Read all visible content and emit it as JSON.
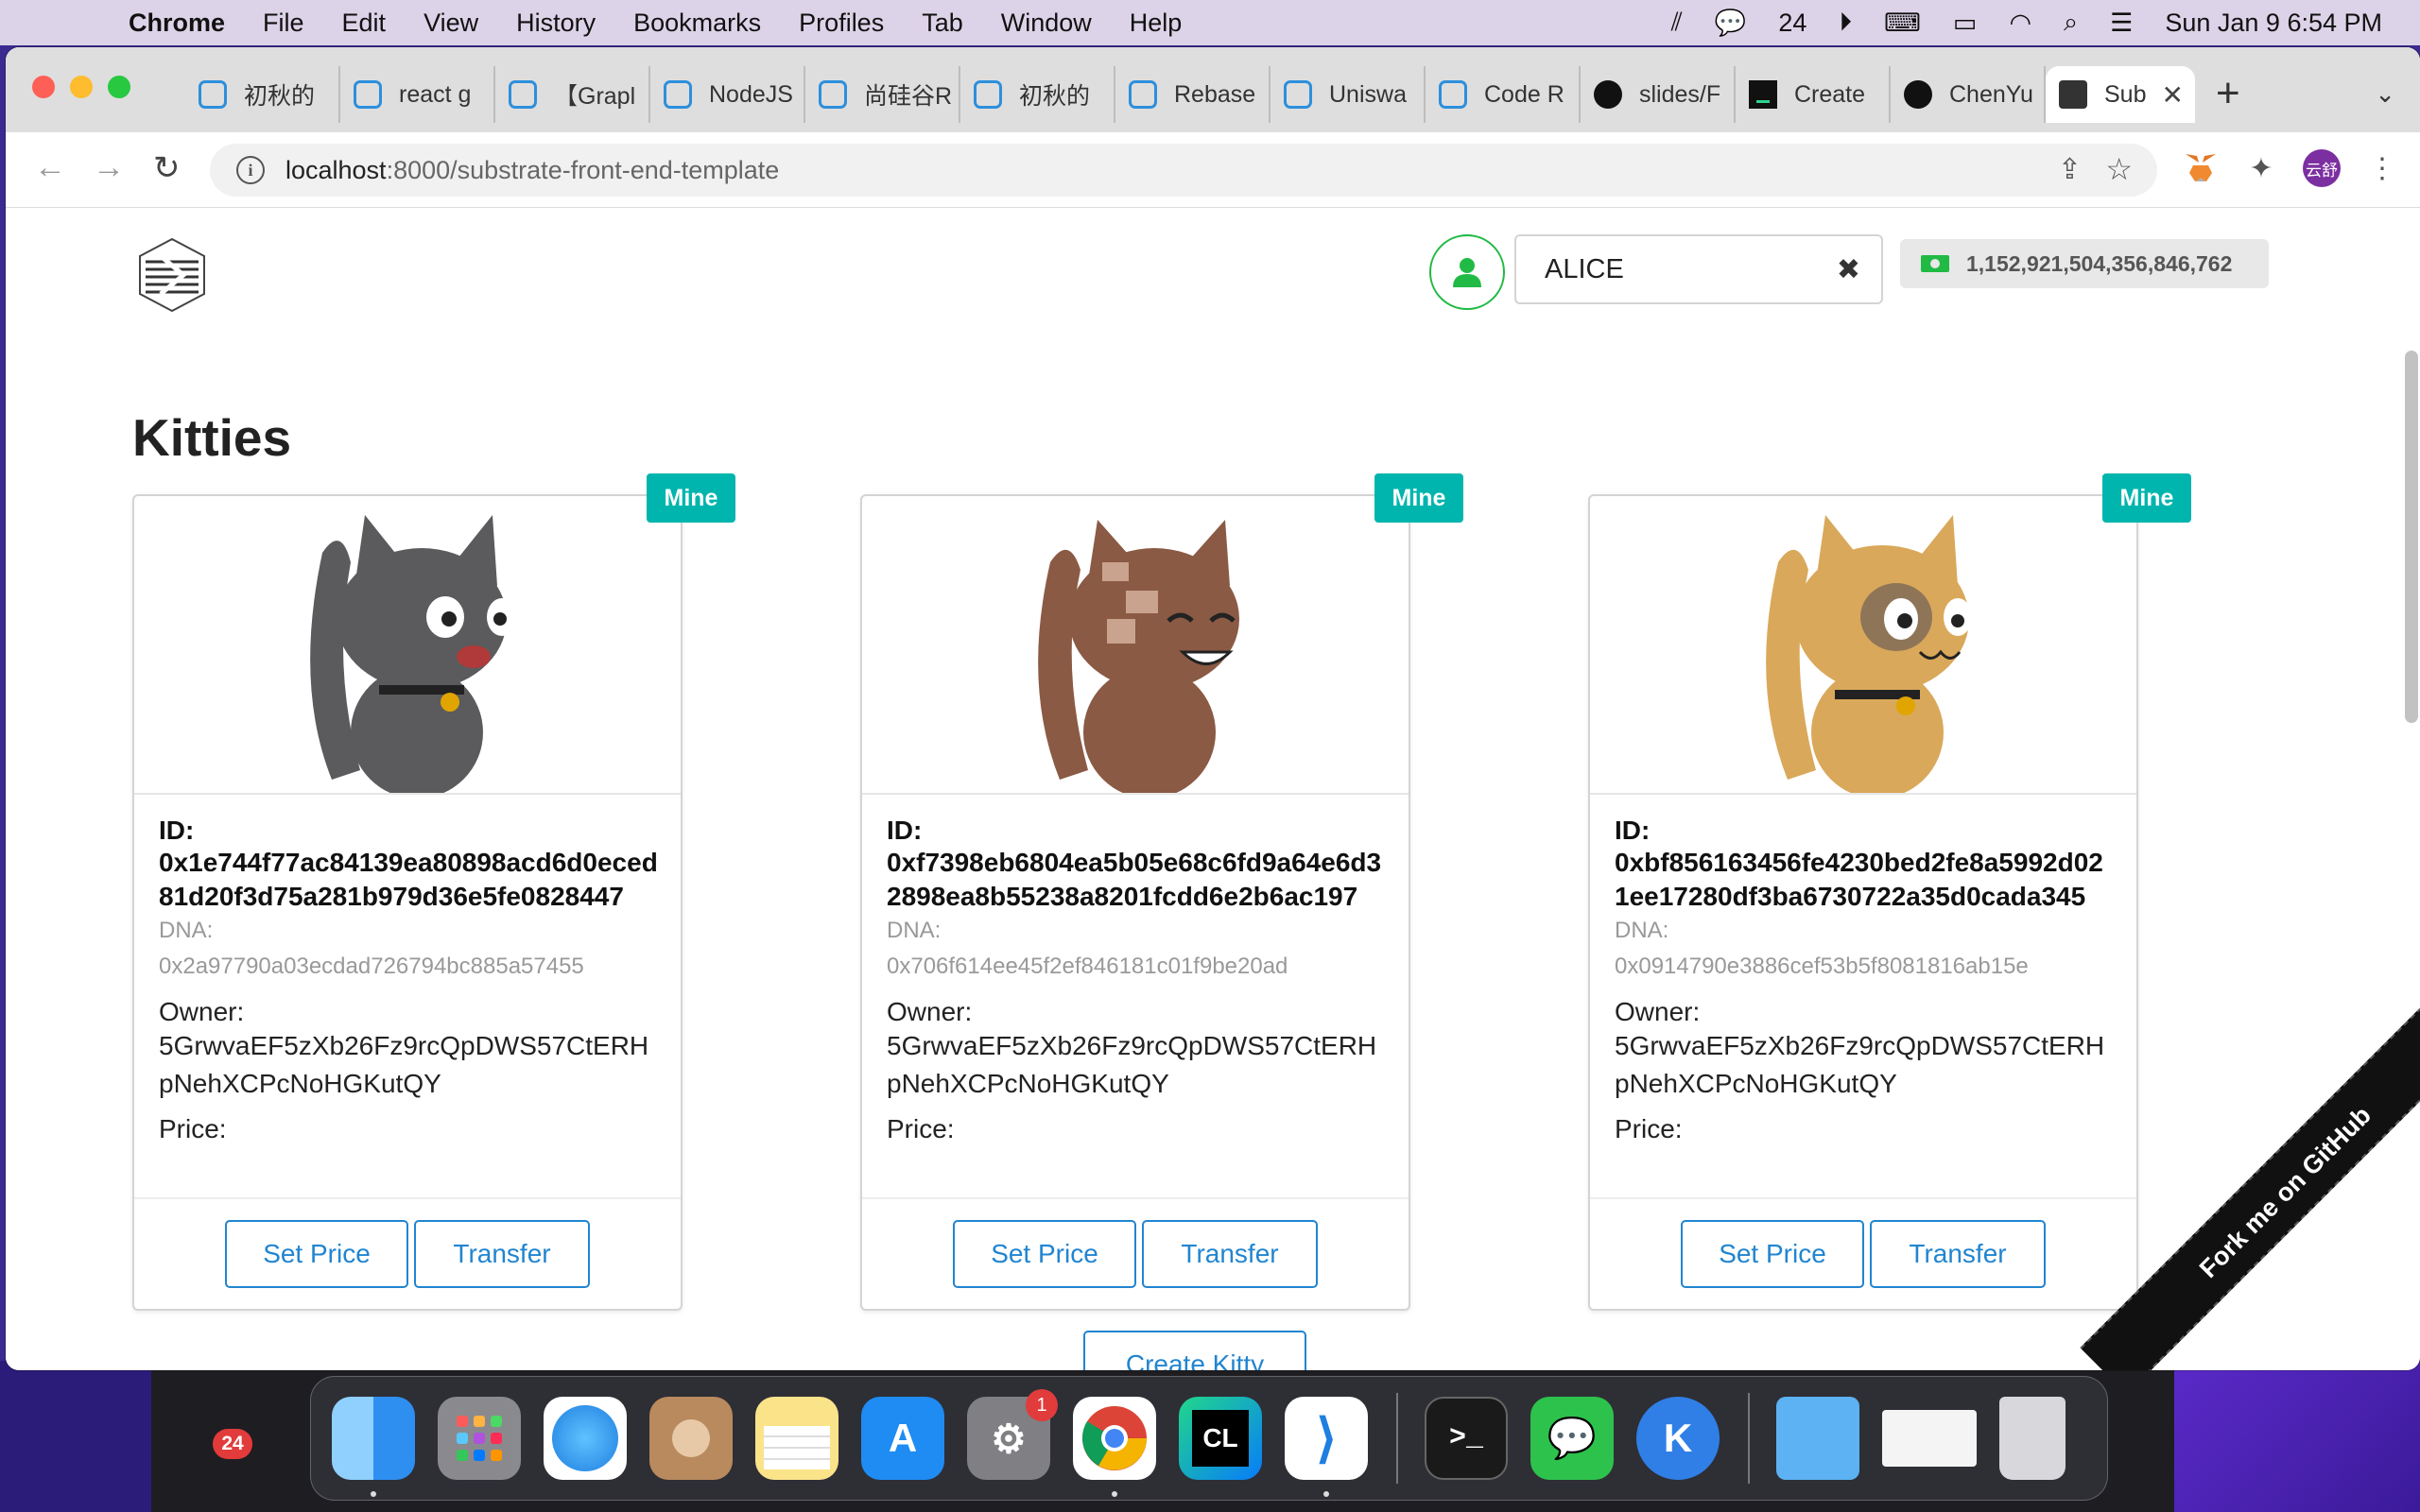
{
  "menubar": {
    "app_name": "Chrome",
    "items": [
      "File",
      "Edit",
      "View",
      "History",
      "Bookmarks",
      "Profiles",
      "Tab",
      "Window",
      "Help"
    ],
    "wechat_count": "24",
    "datetime": "Sun Jan 9  6:54 PM"
  },
  "browser": {
    "tabs": [
      {
        "title": "初秋的",
        "icon": "bilibili-icon"
      },
      {
        "title": "react g",
        "icon": "bilibili-icon"
      },
      {
        "title": "【Grapl",
        "icon": "bilibili-icon"
      },
      {
        "title": "NodeJS",
        "icon": "bilibili-icon"
      },
      {
        "title": "尚硅谷R",
        "icon": "bilibili-icon"
      },
      {
        "title": "初秋的",
        "icon": "bilibili-icon"
      },
      {
        "title": "Rebase",
        "icon": "bilibili-icon"
      },
      {
        "title": "Uniswa",
        "icon": "bilibili-icon"
      },
      {
        "title": "Code R",
        "icon": "bilibili-icon"
      },
      {
        "title": "slides/F",
        "icon": "github-icon"
      },
      {
        "title": "Create",
        "icon": "terminal-icon"
      },
      {
        "title": "ChenYu",
        "icon": "github-icon"
      }
    ],
    "active_tab": {
      "title": "Sub",
      "icon": "substrate-icon"
    },
    "url_host": "localhost",
    "url_path": ":8000/substrate-front-end-template",
    "profile_initials": "云舒"
  },
  "page": {
    "account": {
      "name": "ALICE",
      "balance": "1,152,921,504,356,846,762"
    },
    "heading": "Kitties",
    "labels": {
      "id": "ID:",
      "dna": "DNA:",
      "owner": "Owner:",
      "price": "Price:",
      "ribbon": "Mine",
      "set_price": "Set Price",
      "transfer": "Transfer"
    },
    "kitties": [
      {
        "id": "0x1e744f77ac84139ea80898acd6d0eced81d20f3d75a281b979d36e5fe0828447",
        "dna": "0x2a97790a03ecdad726794bc885a57455",
        "owner": "5GrwvaEF5zXb26Fz9rcQpDWS57CtERHpNehXCPcNoHGKutQY",
        "price": "",
        "color": "#5b5b5e"
      },
      {
        "id": "0xf7398eb6804ea5b05e68c6fd9a64e6d32898ea8b55238a8201fcdd6e2b6ac197",
        "dna": "0x706f614ee45f2ef846181c01f9be20ad",
        "owner": "5GrwvaEF5zXb26Fz9rcQpDWS57CtERHpNehXCPcNoHGKutQY",
        "price": "",
        "color": "#8a5a44"
      },
      {
        "id": "0xbf856163456fe4230bed2fe8a5992d021ee17280df3ba6730722a35d0cada345",
        "dna": "0x0914790e3886cef53b5f8081816ab15e",
        "owner": "5GrwvaEF5zXb26Fz9rcQpDWS57CtERHpNehXCPcNoHGKutQY",
        "price": "",
        "color": "#d9a85a"
      }
    ],
    "create_button": "Create Kitty",
    "fork_ribbon": "Fork me on GitHub"
  },
  "dock": {
    "apps": [
      {
        "name": "finder",
        "color": "#3a9bf0"
      },
      {
        "name": "launchpad",
        "color": "#8a8a8e"
      },
      {
        "name": "safari",
        "color": "#ffffff"
      },
      {
        "name": "contacts",
        "color": "#b98a5e"
      },
      {
        "name": "notes",
        "color": "#fbe38a"
      },
      {
        "name": "app-store",
        "color": "#1e8cf2"
      },
      {
        "name": "system-preferences",
        "color": "#7f7f84",
        "badge": "1"
      },
      {
        "name": "chrome",
        "color": "#ffffff"
      },
      {
        "name": "clion",
        "color": "#1fb39a",
        "label": "CL"
      },
      {
        "name": "vscode",
        "color": "#ffffff"
      },
      {
        "name": "terminal",
        "color": "#1a1a1a",
        "label": ">_"
      },
      {
        "name": "wechat",
        "color": "#2dc24c"
      },
      {
        "name": "klack",
        "color": "#2f7fe6",
        "label": "K"
      }
    ],
    "right": [
      {
        "name": "folder",
        "color": "#5cb2f2"
      },
      {
        "name": "window-preview",
        "color": "#f4f4f4"
      },
      {
        "name": "trash",
        "color": "#d8d8dc"
      }
    ]
  },
  "desktop": {
    "badge": "24"
  }
}
